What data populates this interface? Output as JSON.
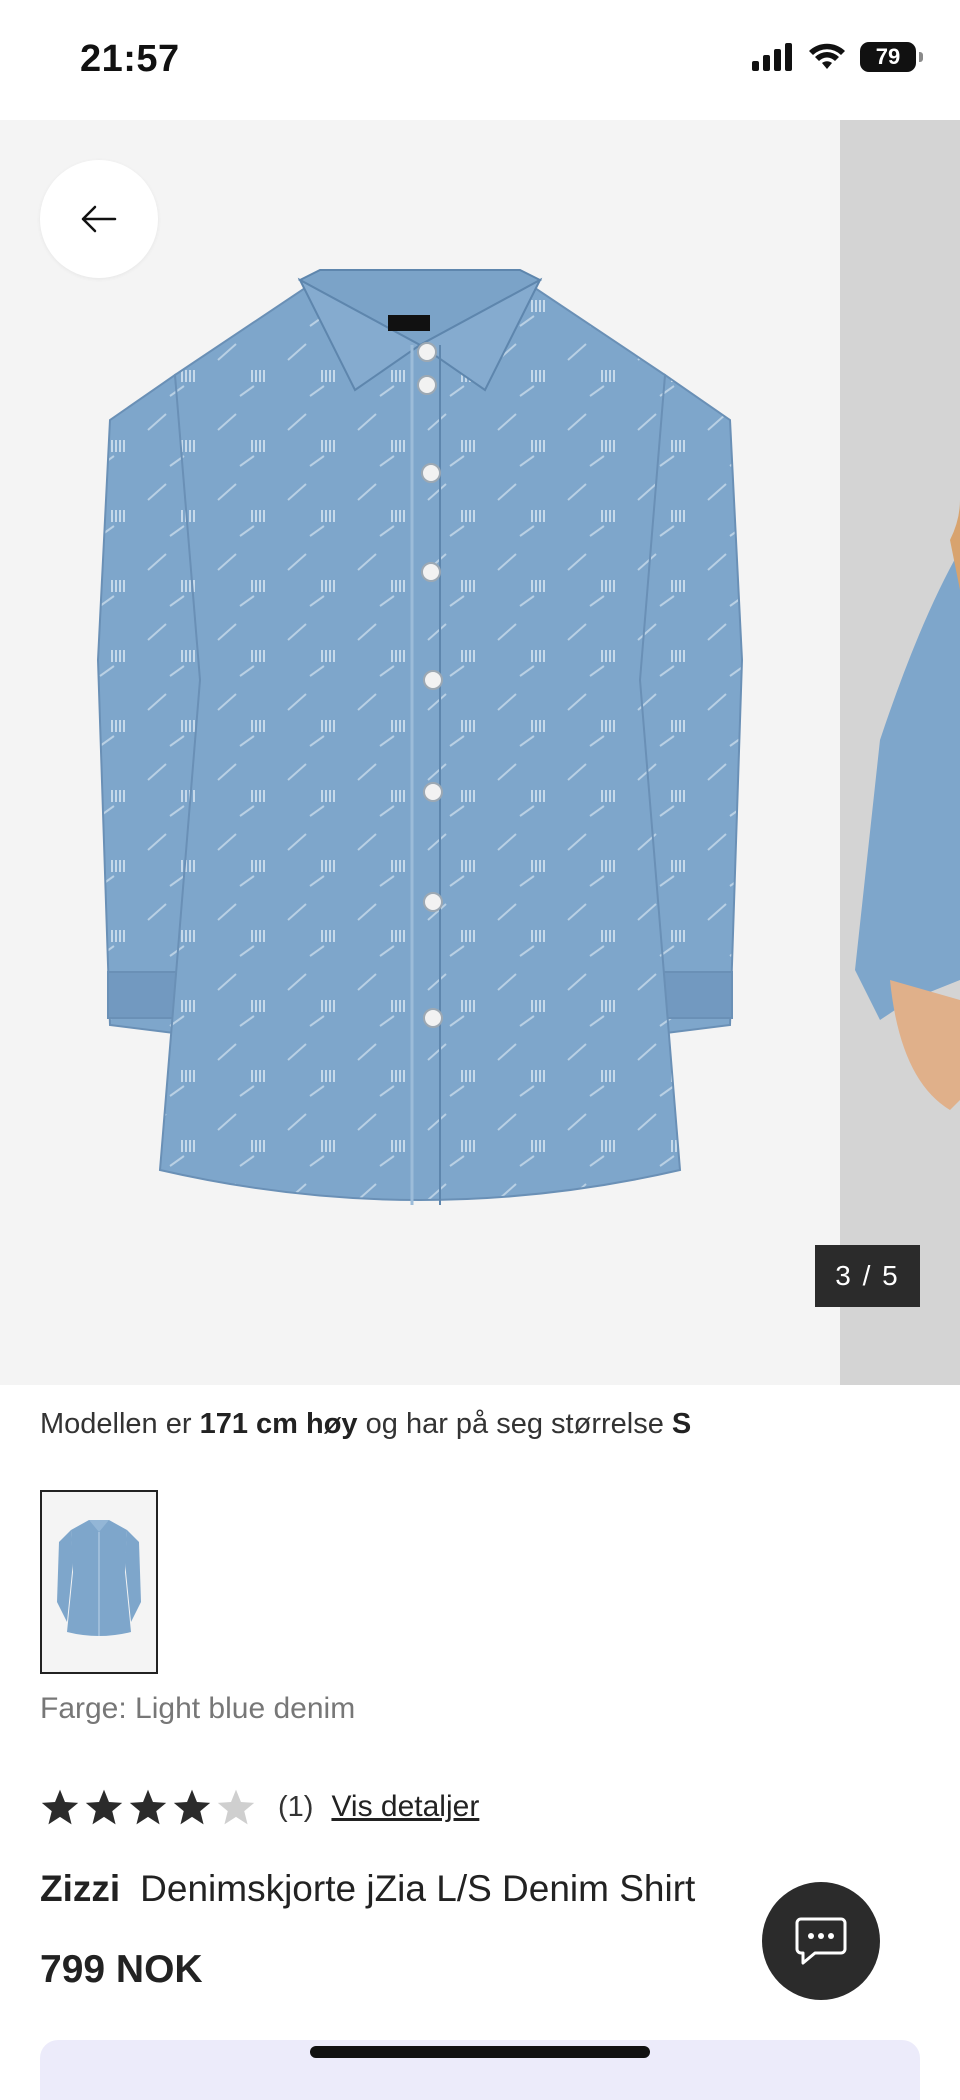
{
  "status_bar": {
    "time": "21:57",
    "battery": "79"
  },
  "gallery": {
    "counter": "3 / 5",
    "thumbnail_brand": "Zizzi"
  },
  "model_info": {
    "prefix": "Modellen er ",
    "height": "171 cm høy",
    "middle": " og har på seg størrelse ",
    "size": "S"
  },
  "product": {
    "color_label": "Farge: Light blue denim",
    "rating": {
      "value": 4,
      "max": 5,
      "count_label": "(1)",
      "details_link": "Vis detaljer"
    },
    "brand": "Zizzi",
    "name": "Denimskjorte jZia L/S Denim Shirt",
    "price": "799 NOK"
  },
  "colors": {
    "denim": "#7aa3c9",
    "dark_button": "#2b2b2b",
    "panel": "#ecebfa"
  },
  "icons": [
    "back-arrow-icon",
    "chat-icon",
    "star-icon",
    "signal-icon",
    "wifi-icon",
    "battery-icon"
  ]
}
